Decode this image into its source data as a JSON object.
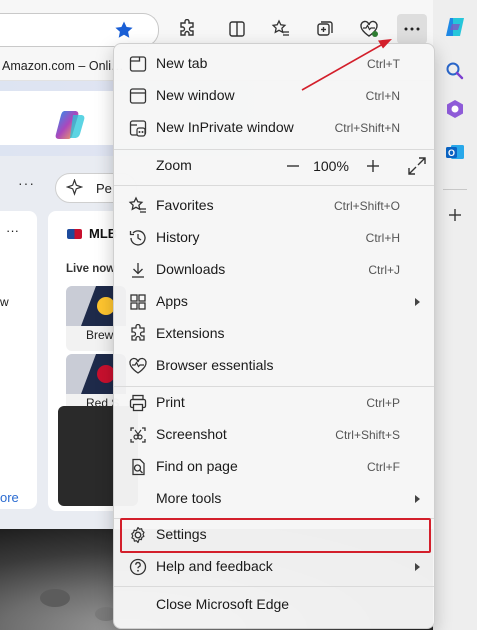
{
  "browser": {
    "favorites_bar_item": "Amazon.com – Onli…"
  },
  "page": {
    "feed_pill_label": "Pe",
    "card_left_text": "w",
    "card_left_more": "ore",
    "mlb": {
      "title": "MLB",
      "live_label": "Live now",
      "games": [
        {
          "label": "Brew"
        },
        {
          "label": "Red S"
        }
      ]
    }
  },
  "menu": {
    "items": [
      {
        "label": "New tab",
        "shortcut": "Ctrl+T",
        "icon": "new-tab-icon"
      },
      {
        "label": "New window",
        "shortcut": "Ctrl+N",
        "icon": "new-window-icon"
      },
      {
        "label": "New InPrivate window",
        "shortcut": "Ctrl+Shift+N",
        "icon": "inprivate-icon"
      }
    ],
    "zoom": {
      "label": "Zoom",
      "minus": "—",
      "value": "100%",
      "plus": "+"
    },
    "items2": [
      {
        "label": "Favorites",
        "shortcut": "Ctrl+Shift+O",
        "icon": "favorites-icon"
      },
      {
        "label": "History",
        "shortcut": "Ctrl+H",
        "icon": "history-icon"
      },
      {
        "label": "Downloads",
        "shortcut": "Ctrl+J",
        "icon": "download-icon"
      },
      {
        "label": "Apps",
        "shortcut": "",
        "icon": "apps-icon"
      },
      {
        "label": "Extensions",
        "shortcut": "",
        "icon": "extensions-icon"
      },
      {
        "label": "Browser essentials",
        "shortcut": "",
        "icon": "heart-pulse-icon"
      }
    ],
    "items3": [
      {
        "label": "Print",
        "shortcut": "Ctrl+P",
        "icon": "print-icon"
      },
      {
        "label": "Screenshot",
        "shortcut": "Ctrl+Shift+S",
        "icon": "screenshot-icon"
      },
      {
        "label": "Find on page",
        "shortcut": "Ctrl+F",
        "icon": "find-icon"
      },
      {
        "label": "More tools",
        "shortcut": "",
        "icon": ""
      }
    ],
    "settings": {
      "label": "Settings",
      "icon": "gear-icon"
    },
    "help": {
      "label": "Help and feedback",
      "icon": "help-icon"
    },
    "close": {
      "label": "Close Microsoft Edge"
    }
  },
  "annotation_color": "#d31f2b"
}
